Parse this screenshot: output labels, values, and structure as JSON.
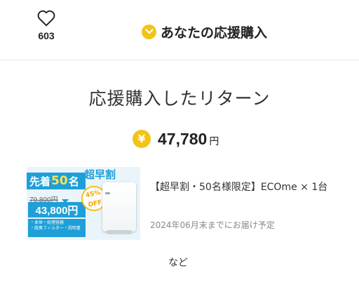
{
  "like": {
    "count": "603"
  },
  "support": {
    "label": "あなたの応援購入"
  },
  "section": {
    "title": "応援購入したリターン"
  },
  "amount": {
    "yen_symbol": "¥",
    "value": "47,780",
    "unit": "円"
  },
  "item": {
    "title": "【超早割・50名様限定】ECOme × 1台",
    "delivery": "2024年06月末までにお届け予定",
    "thumb": {
      "banner_pre": "先着",
      "banner_num": "50",
      "banner_post": "名",
      "super_label": "超早割",
      "old_price": "79,800円",
      "new_price": "43,800円",
      "discount_top": "45%",
      "discount_bottom": "OFF",
      "included": [
        "・本体・処理容器",
        "・脱臭フィルター・説明書"
      ]
    }
  },
  "more": {
    "label": "など"
  },
  "colors": {
    "accent": "#f2c418",
    "brand_blue": "#1f9fd8"
  },
  "icons": {
    "like": "heart-icon",
    "support": "chevron-down-icon",
    "amount": "yen-coin-icon"
  }
}
